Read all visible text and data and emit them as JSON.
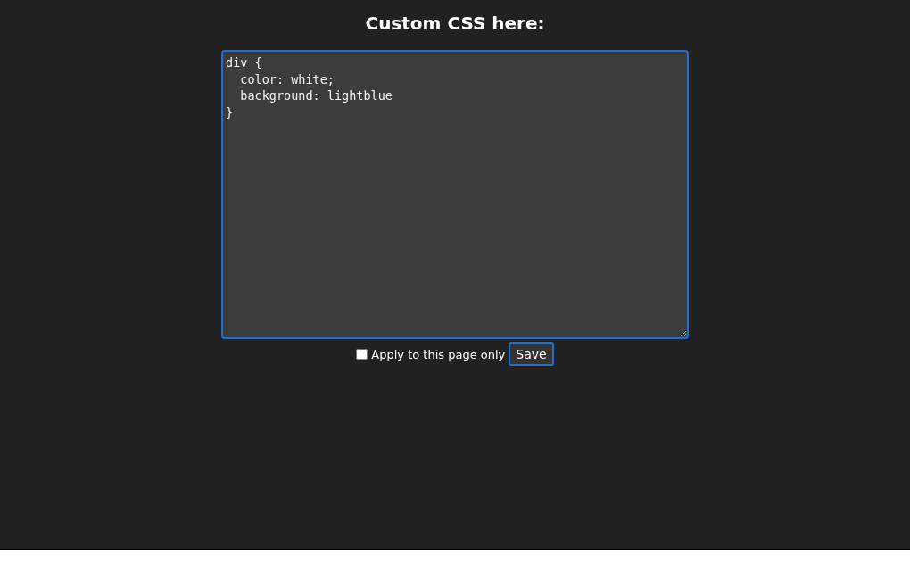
{
  "heading": "Custom CSS here:",
  "editor": {
    "value": "div {\n  color: white;\n  background: lightblue\n}"
  },
  "apply_option": {
    "label": "Apply to this page only",
    "checked": false
  },
  "save_button": {
    "label": "Save"
  }
}
